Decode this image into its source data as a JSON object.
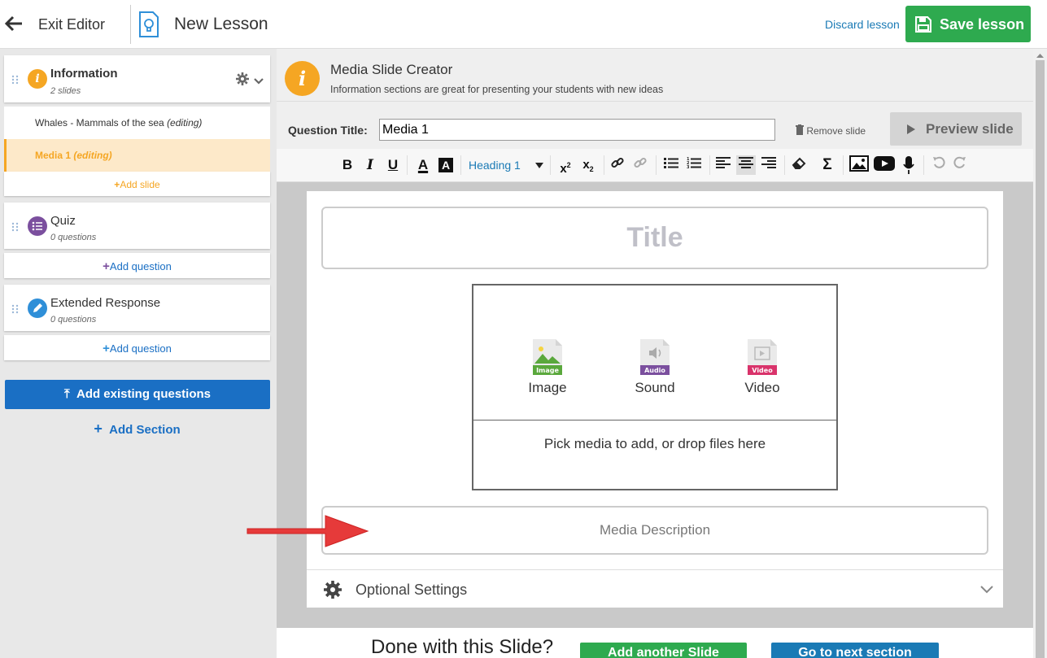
{
  "topbar": {
    "exit_label": "Exit Editor",
    "lesson_title": "New Lesson",
    "discard_label": "Discard lesson",
    "save_label": "Save lesson",
    "save_color": "#2eaa4f"
  },
  "sidebar": {
    "sections": [
      {
        "title": "Information",
        "subtitle": "2 slides",
        "icon": "info-icon",
        "color": "#f5a623"
      },
      {
        "title": "Quiz",
        "subtitle": "0 questions",
        "icon": "quiz-list-icon",
        "color": "#7b4f9e"
      },
      {
        "title": "Extended Response",
        "subtitle": "0 questions",
        "icon": "pencil-icon",
        "color": "#2f8fd8"
      }
    ],
    "slides": [
      {
        "name": "Whales - Mammals of the sea",
        "status": "(editing)"
      },
      {
        "name": "Media 1",
        "status": "(editing)"
      }
    ],
    "add_slide": "Add slide",
    "add_question": "Add question",
    "add_existing": "Add existing questions",
    "add_section": "Add Section"
  },
  "creator": {
    "title": "Media Slide Creator",
    "subtitle": "Information sections are great for presenting your students with new ideas",
    "question_label": "Question Title:",
    "question_value": "Media 1",
    "remove_label": "Remove slide",
    "preview_label": "Preview slide",
    "heading_option": "Heading 1"
  },
  "editor": {
    "title_placeholder": "Title",
    "media_options": [
      {
        "label": "Image",
        "tag": "Image",
        "color": "#5aa83c"
      },
      {
        "label": "Sound",
        "tag": "Audio",
        "color": "#7b4f9e"
      },
      {
        "label": "Video",
        "tag": "Video",
        "color": "#d9336b"
      }
    ],
    "pick_text": "Pick media to add, or drop files here",
    "description_placeholder": "Media Description",
    "optional_settings": "Optional Settings"
  },
  "footer": {
    "done_text": "Done with this Slide?",
    "add_another": "Add another Slide",
    "next_section": "Go to next section"
  }
}
